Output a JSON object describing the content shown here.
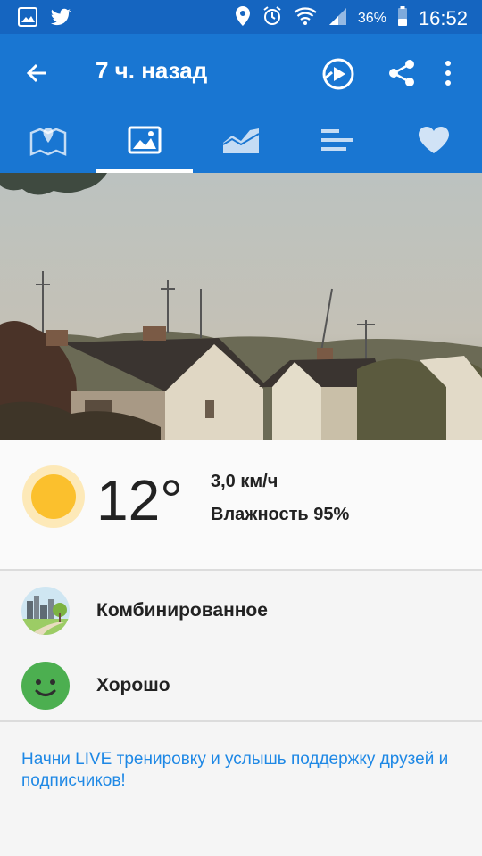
{
  "status_bar": {
    "battery": "36%",
    "time": "16:52",
    "left_icons": [
      "gallery-icon",
      "twitter-icon"
    ],
    "right_icons": [
      "location-icon",
      "alarm-icon",
      "wifi-icon",
      "signal-icon",
      "battery-icon"
    ]
  },
  "header": {
    "title": "7 ч. назад",
    "actions": [
      "play-route-icon",
      "share-icon",
      "more-vert-icon"
    ]
  },
  "tabs": {
    "items": [
      "map-icon",
      "photo-icon",
      "chart-icon",
      "stats-icon",
      "heart-icon"
    ],
    "selected": 1
  },
  "weather": {
    "temperature": "12°",
    "wind": "3,0 км/ч",
    "humidity": "Влажность 95%"
  },
  "surface": {
    "label": "Комбинированное"
  },
  "feeling": {
    "label": "Хорошо"
  },
  "live": {
    "text": "Начни LIVE тренировку и услышь поддержку друзей и подписчиков!"
  },
  "colors": {
    "status_bar": "#1565c0",
    "app_bar": "#1976d2",
    "link": "#1e88e5",
    "feeling_green": "#4caf50",
    "sun": "#fbc02d"
  }
}
